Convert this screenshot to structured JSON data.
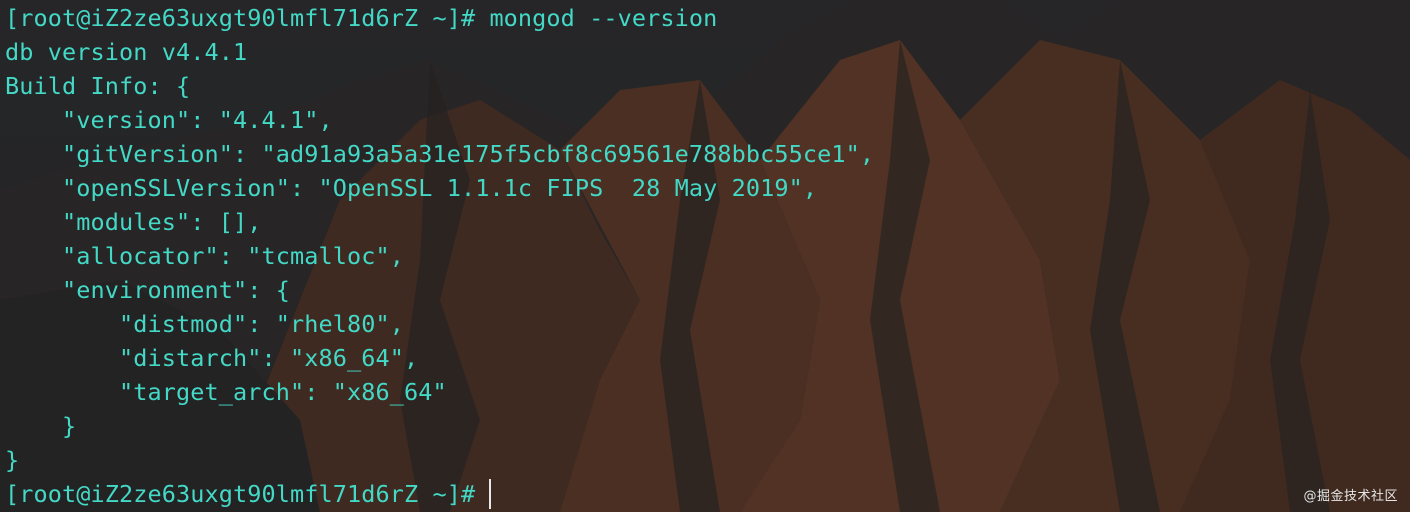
{
  "theme": {
    "text_color": "#43d9c6",
    "background_color": "#2a2a2c",
    "cursor_color": "#e8e8e8"
  },
  "terminal": {
    "lines": [
      "[root@iZ2ze63uxgt90lmfl71d6rZ ~]# mongod --version",
      "db version v4.4.1",
      "Build Info: {",
      "    \"version\": \"4.4.1\",",
      "    \"gitVersion\": \"ad91a93a5a31e175f5cbf8c69561e788bbc55ce1\",",
      "    \"openSSLVersion\": \"OpenSSL 1.1.1c FIPS  28 May 2019\",",
      "    \"modules\": [],",
      "    \"allocator\": \"tcmalloc\",",
      "    \"environment\": {",
      "        \"distmod\": \"rhel80\",",
      "        \"distarch\": \"x86_64\",",
      "        \"target_arch\": \"x86_64\"",
      "    }",
      "}"
    ],
    "prompt": "[root@iZ2ze63uxgt90lmfl71d6rZ ~]#"
  },
  "watermark": "@掘金技术社区"
}
